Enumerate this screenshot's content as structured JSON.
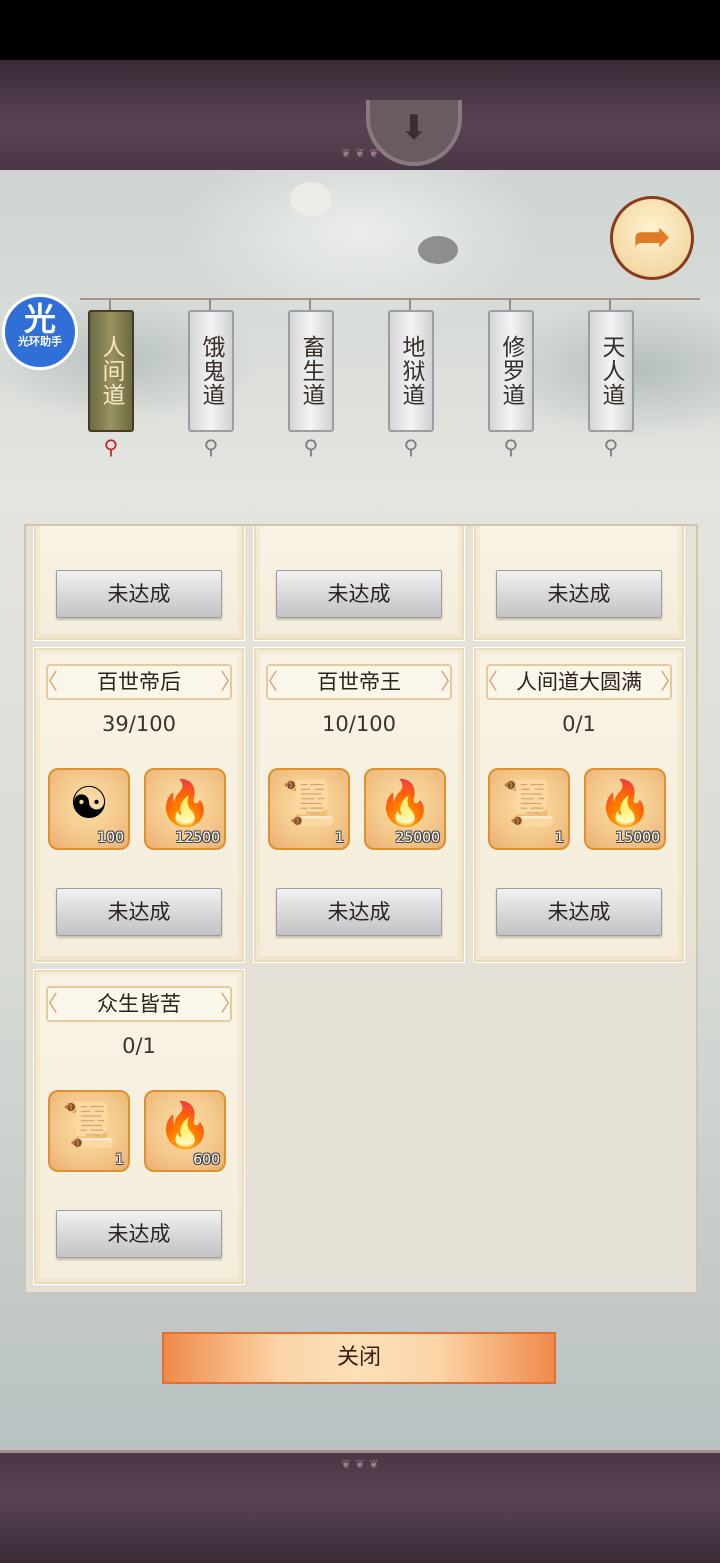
{
  "tabs": [
    {
      "label": "人间道",
      "active": true
    },
    {
      "label": "饿鬼道",
      "active": false
    },
    {
      "label": "畜生道",
      "active": false
    },
    {
      "label": "地狱道",
      "active": false
    },
    {
      "label": "修罗道",
      "active": false
    },
    {
      "label": "天人道",
      "active": false
    }
  ],
  "helper": {
    "glyph": "光",
    "caption": "光环助手"
  },
  "back_icon": "back-arrow-icon",
  "top_knob_icon": "down-arrow-icon",
  "cards_top_row": [
    {
      "button": "未达成"
    },
    {
      "button": "未达成"
    },
    {
      "button": "未达成"
    }
  ],
  "cards": [
    {
      "title": "百世帝后",
      "progress": "39/100",
      "rewards": [
        {
          "icon": "taiji-compass-icon",
          "qty": "100"
        },
        {
          "icon": "spirit-flame-icon",
          "qty": "12500"
        }
      ],
      "button": "未达成"
    },
    {
      "title": "百世帝王",
      "progress": "10/100",
      "rewards": [
        {
          "icon": "scroll-book-icon",
          "qty": "1"
        },
        {
          "icon": "spirit-flame-icon",
          "qty": "25000"
        }
      ],
      "button": "未达成"
    },
    {
      "title": "人间道大圆满",
      "progress": "0/1",
      "rewards": [
        {
          "icon": "scroll-book-icon",
          "qty": "1"
        },
        {
          "icon": "spirit-flame-icon",
          "qty": "15000"
        }
      ],
      "button": "未达成"
    },
    {
      "title": "众生皆苦",
      "progress": "0/1",
      "rewards": [
        {
          "icon": "scroll-book-icon",
          "qty": "1"
        },
        {
          "icon": "spirit-flame-icon",
          "qty": "600"
        }
      ],
      "button": "未达成"
    }
  ],
  "close_button": "关闭",
  "colors": {
    "accent": "#e56f2e",
    "active_tab": "#9a9360",
    "tassel_active": "#c0282a"
  }
}
